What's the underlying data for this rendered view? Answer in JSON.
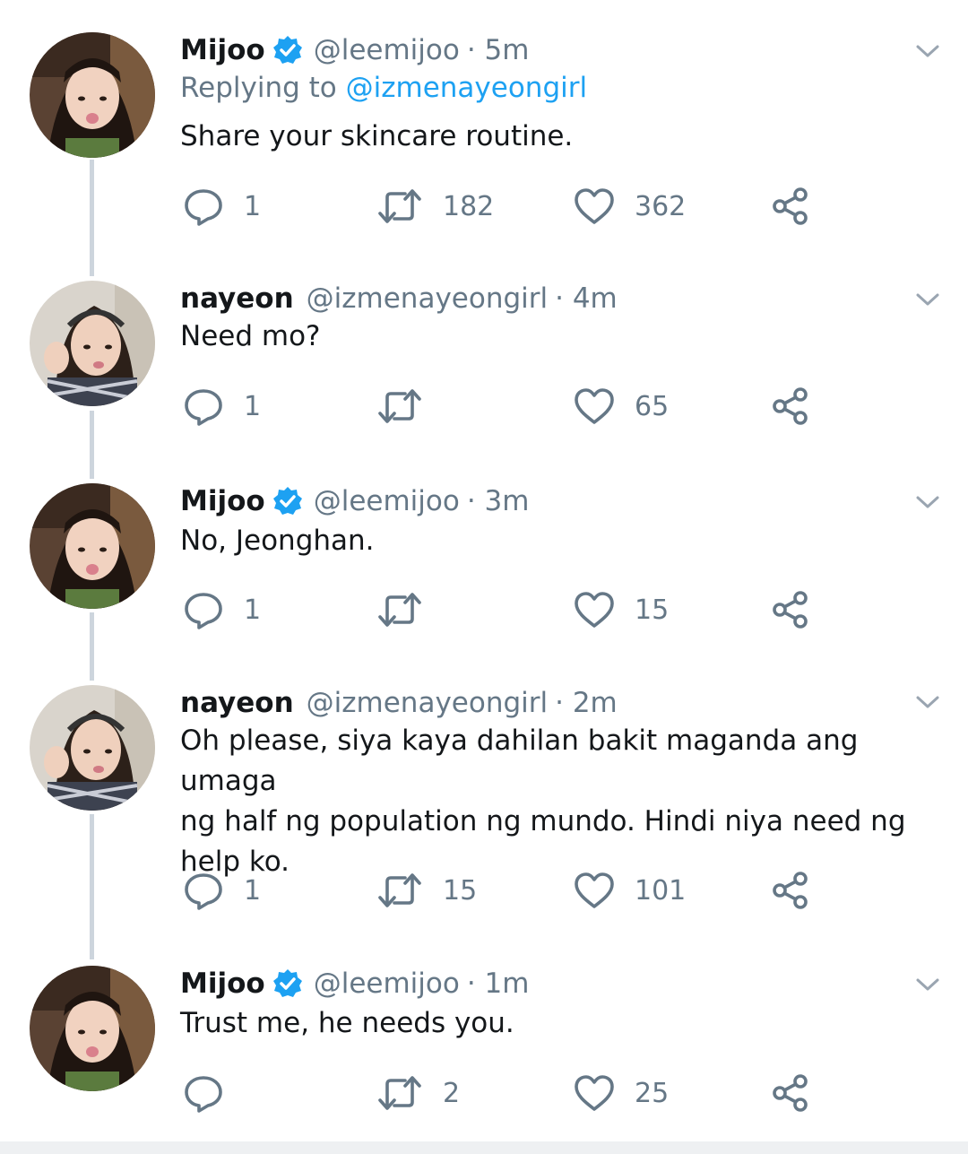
{
  "colors": {
    "link": "#1da1f2",
    "secondary": "#657786",
    "thread_line": "#cdd5dd",
    "verified": "#1da1f2"
  },
  "icons": {
    "reply": "reply-icon",
    "retweet": "retweet-icon",
    "like": "heart-icon",
    "share": "share-icon",
    "more": "chevron-down-icon",
    "verified": "verified-badge-icon"
  },
  "tweets": [
    {
      "name": "Mijoo",
      "verified": true,
      "handle": "@leemijoo",
      "time": "· 5m",
      "replying_prefix": "Replying to ",
      "replying_to": "@izmenayeongirl",
      "text": "Share your skincare routine.",
      "replies": "1",
      "retweets": "182",
      "likes": "362"
    },
    {
      "name": "nayeon",
      "verified": false,
      "handle": "@izmenayeongirl",
      "time": "· 4m",
      "text": "Need mo?",
      "replies": "1",
      "retweets": "",
      "likes": "65"
    },
    {
      "name": "Mijoo",
      "verified": true,
      "handle": "@leemijoo",
      "time": "· 3m",
      "text": "No, Jeonghan.",
      "replies": "1",
      "retweets": "",
      "likes": "15"
    },
    {
      "name": "nayeon",
      "verified": false,
      "handle": "@izmenayeongirl",
      "time": "· 2m",
      "text_lines": [
        "Oh please, siya kaya dahilan bakit maganda ang umaga",
        "ng half ng population ng mundo. Hindi niya need ng",
        "help ko."
      ],
      "replies": "1",
      "retweets": "15",
      "likes": "101"
    },
    {
      "name": "Mijoo",
      "verified": true,
      "handle": "@leemijoo",
      "time": "· 1m",
      "text": "Trust me, he needs you.",
      "replies": "",
      "retweets": "2",
      "likes": "25"
    }
  ]
}
